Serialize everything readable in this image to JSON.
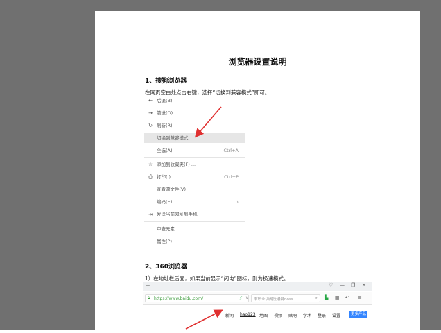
{
  "document": {
    "title": "浏览器设置说明",
    "section1": {
      "heading": "1、搜狗浏览器",
      "instruction": "在网页空白处点击右键，选择“切换到兼容模式”即可。"
    },
    "context_menu": {
      "items": [
        {
          "icon": "arrow-left-icon",
          "glyph": "←",
          "label": "后退(B)",
          "shortcut": "",
          "highlight": false
        },
        {
          "icon": "arrow-right-icon",
          "glyph": "→",
          "label": "前进(O)",
          "shortcut": "",
          "highlight": false
        },
        {
          "icon": "refresh-icon",
          "glyph": "↻",
          "label": "刷新(R)",
          "shortcut": "",
          "highlight": false
        },
        {
          "icon": "",
          "glyph": "",
          "label": "切换到兼容模式",
          "shortcut": "",
          "highlight": true
        },
        {
          "icon": "",
          "glyph": "",
          "label": "全选(A)",
          "shortcut": "Ctrl+A",
          "highlight": false
        },
        {
          "icon": "star-icon",
          "glyph": "☆",
          "label": "添加到收藏夹(F) ...",
          "shortcut": "",
          "highlight": false
        },
        {
          "icon": "printer-icon",
          "glyph": "⎙",
          "label": "打印(I) ...",
          "shortcut": "Ctrl+P",
          "highlight": false
        },
        {
          "icon": "",
          "glyph": "",
          "label": "查看源文件(V)",
          "shortcut": "",
          "highlight": false
        },
        {
          "icon": "",
          "glyph": "",
          "label": "编码(E)",
          "shortcut": "›",
          "highlight": false
        },
        {
          "icon": "send-to-phone-icon",
          "glyph": "⇥",
          "label": "发送当前网址到手机",
          "shortcut": "",
          "highlight": false
        },
        {
          "icon": "",
          "glyph": "",
          "label": "审查元素",
          "shortcut": "",
          "highlight": false
        },
        {
          "icon": "",
          "glyph": "",
          "label": "属性(P)",
          "shortcut": "",
          "highlight": false
        }
      ]
    },
    "section2": {
      "heading": "2、360浏览器",
      "instruction": "1）在地址栏后面，如果当前显示“闪电”图标，则为极速模式。"
    },
    "browser": {
      "tab_plus": "+",
      "window_controls": [
        "♡",
        "—",
        "❐",
        "✕"
      ],
      "url": "https://www.baidu.com/",
      "search_placeholder": "率职业切阁洗通特boss",
      "links": [
        "新闻",
        "hao123",
        "地图",
        "视频",
        "贴吧",
        "学术",
        "登录",
        "设置"
      ],
      "more_button": "更多产品"
    }
  }
}
